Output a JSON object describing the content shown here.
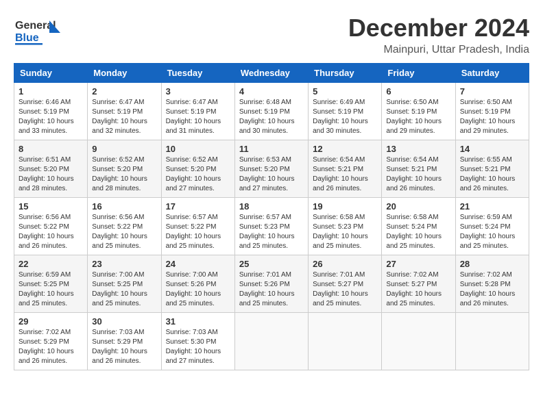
{
  "logo": {
    "line1": "General",
    "line2": "Blue"
  },
  "title": "December 2024",
  "subtitle": "Mainpuri, Uttar Pradesh, India",
  "days_of_week": [
    "Sunday",
    "Monday",
    "Tuesday",
    "Wednesday",
    "Thursday",
    "Friday",
    "Saturday"
  ],
  "weeks": [
    [
      {
        "day": "1",
        "info": "Sunrise: 6:46 AM\nSunset: 5:19 PM\nDaylight: 10 hours\nand 33 minutes."
      },
      {
        "day": "2",
        "info": "Sunrise: 6:47 AM\nSunset: 5:19 PM\nDaylight: 10 hours\nand 32 minutes."
      },
      {
        "day": "3",
        "info": "Sunrise: 6:47 AM\nSunset: 5:19 PM\nDaylight: 10 hours\nand 31 minutes."
      },
      {
        "day": "4",
        "info": "Sunrise: 6:48 AM\nSunset: 5:19 PM\nDaylight: 10 hours\nand 30 minutes."
      },
      {
        "day": "5",
        "info": "Sunrise: 6:49 AM\nSunset: 5:19 PM\nDaylight: 10 hours\nand 30 minutes."
      },
      {
        "day": "6",
        "info": "Sunrise: 6:50 AM\nSunset: 5:19 PM\nDaylight: 10 hours\nand 29 minutes."
      },
      {
        "day": "7",
        "info": "Sunrise: 6:50 AM\nSunset: 5:19 PM\nDaylight: 10 hours\nand 29 minutes."
      }
    ],
    [
      {
        "day": "8",
        "info": "Sunrise: 6:51 AM\nSunset: 5:20 PM\nDaylight: 10 hours\nand 28 minutes."
      },
      {
        "day": "9",
        "info": "Sunrise: 6:52 AM\nSunset: 5:20 PM\nDaylight: 10 hours\nand 28 minutes."
      },
      {
        "day": "10",
        "info": "Sunrise: 6:52 AM\nSunset: 5:20 PM\nDaylight: 10 hours\nand 27 minutes."
      },
      {
        "day": "11",
        "info": "Sunrise: 6:53 AM\nSunset: 5:20 PM\nDaylight: 10 hours\nand 27 minutes."
      },
      {
        "day": "12",
        "info": "Sunrise: 6:54 AM\nSunset: 5:21 PM\nDaylight: 10 hours\nand 26 minutes."
      },
      {
        "day": "13",
        "info": "Sunrise: 6:54 AM\nSunset: 5:21 PM\nDaylight: 10 hours\nand 26 minutes."
      },
      {
        "day": "14",
        "info": "Sunrise: 6:55 AM\nSunset: 5:21 PM\nDaylight: 10 hours\nand 26 minutes."
      }
    ],
    [
      {
        "day": "15",
        "info": "Sunrise: 6:56 AM\nSunset: 5:22 PM\nDaylight: 10 hours\nand 26 minutes."
      },
      {
        "day": "16",
        "info": "Sunrise: 6:56 AM\nSunset: 5:22 PM\nDaylight: 10 hours\nand 25 minutes."
      },
      {
        "day": "17",
        "info": "Sunrise: 6:57 AM\nSunset: 5:22 PM\nDaylight: 10 hours\nand 25 minutes."
      },
      {
        "day": "18",
        "info": "Sunrise: 6:57 AM\nSunset: 5:23 PM\nDaylight: 10 hours\nand 25 minutes."
      },
      {
        "day": "19",
        "info": "Sunrise: 6:58 AM\nSunset: 5:23 PM\nDaylight: 10 hours\nand 25 minutes."
      },
      {
        "day": "20",
        "info": "Sunrise: 6:58 AM\nSunset: 5:24 PM\nDaylight: 10 hours\nand 25 minutes."
      },
      {
        "day": "21",
        "info": "Sunrise: 6:59 AM\nSunset: 5:24 PM\nDaylight: 10 hours\nand 25 minutes."
      }
    ],
    [
      {
        "day": "22",
        "info": "Sunrise: 6:59 AM\nSunset: 5:25 PM\nDaylight: 10 hours\nand 25 minutes."
      },
      {
        "day": "23",
        "info": "Sunrise: 7:00 AM\nSunset: 5:25 PM\nDaylight: 10 hours\nand 25 minutes."
      },
      {
        "day": "24",
        "info": "Sunrise: 7:00 AM\nSunset: 5:26 PM\nDaylight: 10 hours\nand 25 minutes."
      },
      {
        "day": "25",
        "info": "Sunrise: 7:01 AM\nSunset: 5:26 PM\nDaylight: 10 hours\nand 25 minutes."
      },
      {
        "day": "26",
        "info": "Sunrise: 7:01 AM\nSunset: 5:27 PM\nDaylight: 10 hours\nand 25 minutes."
      },
      {
        "day": "27",
        "info": "Sunrise: 7:02 AM\nSunset: 5:27 PM\nDaylight: 10 hours\nand 25 minutes."
      },
      {
        "day": "28",
        "info": "Sunrise: 7:02 AM\nSunset: 5:28 PM\nDaylight: 10 hours\nand 26 minutes."
      }
    ],
    [
      {
        "day": "29",
        "info": "Sunrise: 7:02 AM\nSunset: 5:29 PM\nDaylight: 10 hours\nand 26 minutes."
      },
      {
        "day": "30",
        "info": "Sunrise: 7:03 AM\nSunset: 5:29 PM\nDaylight: 10 hours\nand 26 minutes."
      },
      {
        "day": "31",
        "info": "Sunrise: 7:03 AM\nSunset: 5:30 PM\nDaylight: 10 hours\nand 27 minutes."
      },
      {
        "day": "",
        "info": ""
      },
      {
        "day": "",
        "info": ""
      },
      {
        "day": "",
        "info": ""
      },
      {
        "day": "",
        "info": ""
      }
    ]
  ]
}
